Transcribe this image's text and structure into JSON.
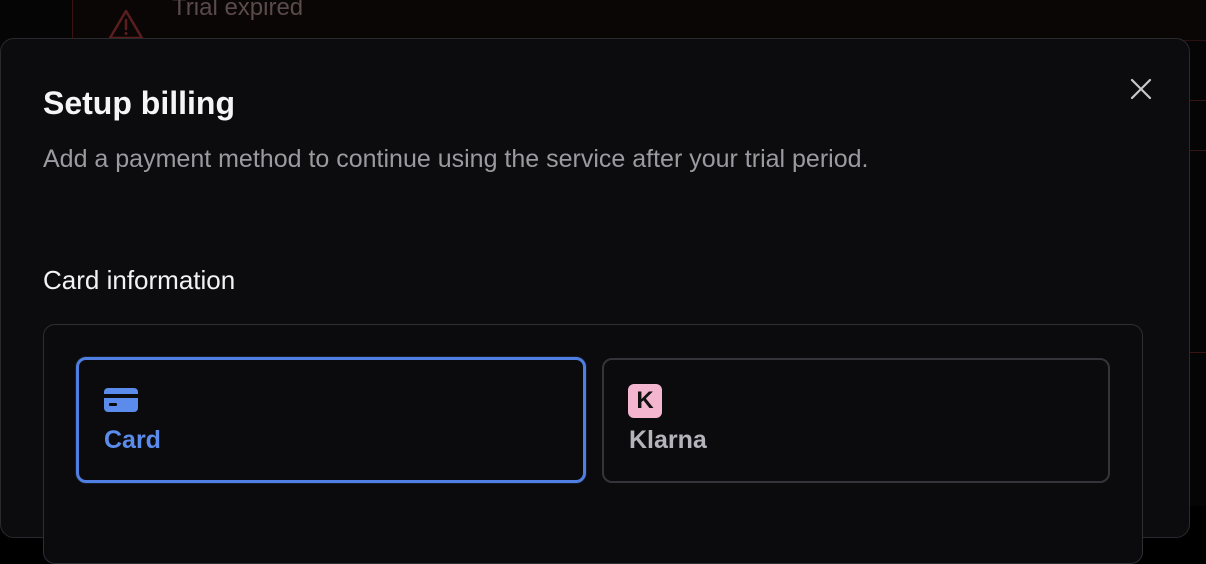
{
  "background": {
    "banner_text": "Trial expired",
    "warning_icon": "warning-triangle-icon"
  },
  "modal": {
    "title": "Setup billing",
    "subtitle": "Add a payment method to continue using the service after your trial period.",
    "close_icon": "close-icon"
  },
  "payment": {
    "section_label": "Card information",
    "methods": [
      {
        "label": "Card",
        "icon": "credit-card-icon",
        "selected": true
      },
      {
        "label": "Klarna",
        "icon": "klarna-logo-icon",
        "icon_letter": "K",
        "selected": false
      }
    ]
  },
  "colors": {
    "accent": "#4f7fe0",
    "accent_text": "#5b8cec",
    "klarna_pink": "#f4b6cf",
    "modal_bg": "#0c0c0f"
  }
}
